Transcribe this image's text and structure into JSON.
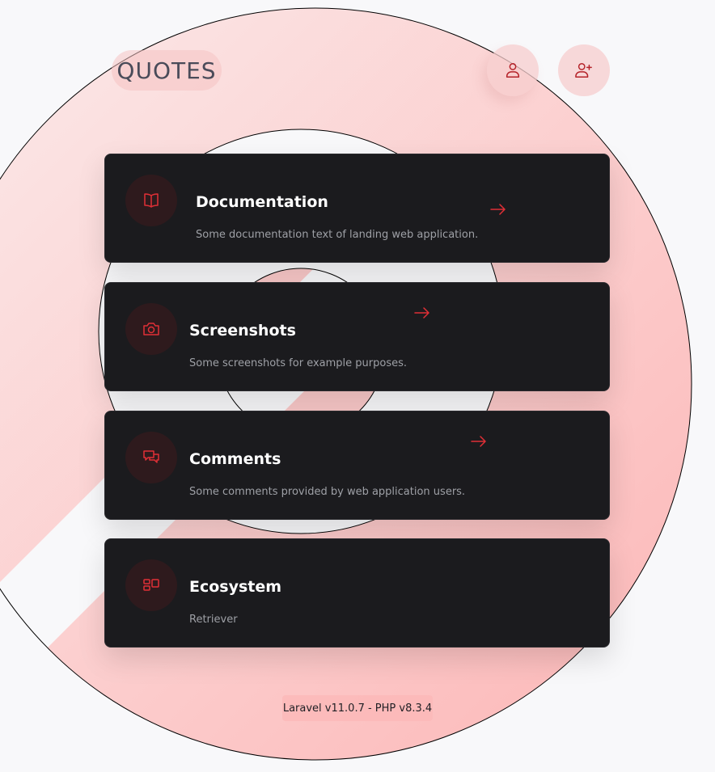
{
  "header": {
    "logo_text": "QUOTES",
    "login_icon": "user-icon",
    "register_icon": "user-plus-icon"
  },
  "cards": [
    {
      "icon": "book-open-icon",
      "title": "Documentation",
      "description": "Some documentation text of landing web application.",
      "arrow_icon": "arrow-right-icon"
    },
    {
      "icon": "camera-icon",
      "title": "Screenshots",
      "description": "Some screenshots for example purposes.",
      "arrow_icon": "arrow-right-icon"
    },
    {
      "icon": "chat-bubbles-icon",
      "title": "Comments",
      "description": "Some comments provided by web application users.",
      "arrow_icon": "arrow-right-icon"
    },
    {
      "icon": "grid-blocks-icon",
      "title": "Ecosystem",
      "description": "Retriever"
    }
  ],
  "footer": {
    "version_text": "Laravel v11.0.7 - PHP v8.3.4"
  },
  "colors": {
    "accent": "#e02f36",
    "card_bg": "#1b1b1e",
    "badge_bg": "#2e1a1d",
    "page_bg": "#f8f8fa",
    "pink": "#fcbaba"
  }
}
